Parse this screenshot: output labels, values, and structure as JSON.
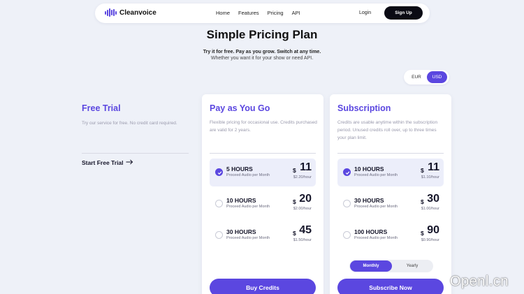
{
  "nav": {
    "logo_text": "Cleanvoice",
    "links": [
      "Home",
      "Features",
      "Pricing",
      "API"
    ],
    "login": "Login",
    "signup": "Sign Up"
  },
  "header": {
    "title": "Simple Pricing Plan",
    "subtitle_bold": "Try it for free. Pay as you grow. Switch at any time.",
    "subtitle": "Whether you want it for your show or need API."
  },
  "currency": {
    "options": [
      "EUR",
      "USD"
    ],
    "selected": "USD",
    "accent": "#5b47e0"
  },
  "free_trial": {
    "title": "Free Trial",
    "desc": "Try our service for free. No credit card required.",
    "link": "Start Free Trial",
    "link_icon": "arrow-right-icon"
  },
  "payg": {
    "title": "Pay as You Go",
    "desc": "Flexible pricing for occasional use. Credits purchased are valid for 2 years.",
    "plans": [
      {
        "hours": "5 HOURS",
        "sub": "Proceed Audio per Month",
        "currency": "$",
        "price": "11",
        "rate": "$2.20/hour",
        "selected": true
      },
      {
        "hours": "10 HOURS",
        "sub": "Proceed Audio per Month",
        "currency": "$",
        "price": "20",
        "rate": "$2.00/hour",
        "selected": false
      },
      {
        "hours": "30 HOURS",
        "sub": "Proceed Audio per Month",
        "currency": "$",
        "price": "45",
        "rate": "$1.50/hour",
        "selected": false
      }
    ],
    "cta": "Buy Credits"
  },
  "subscription": {
    "title": "Subscription",
    "desc": "Credits are usable anytime within the subscription period. Unused credits roll over, up to three times your plan limit.",
    "plans": [
      {
        "hours": "10 HOURS",
        "sub": "Proceed Audio per Month",
        "currency": "$",
        "price": "11",
        "rate": "$1.10/hour",
        "selected": true
      },
      {
        "hours": "30 HOURS",
        "sub": "Proceed Audio per Month",
        "currency": "$",
        "price": "30",
        "rate": "$1.00/hour",
        "selected": false
      },
      {
        "hours": "100 HOURS",
        "sub": "Proceed Audio per Month",
        "currency": "$",
        "price": "90",
        "rate": "$0.90/hour",
        "selected": false
      }
    ],
    "billing": {
      "monthly": "Monthly",
      "yearly": "Yearly",
      "selected": "Monthly"
    },
    "cta": "Subscribe Now"
  },
  "watermark": "Openl.cn"
}
